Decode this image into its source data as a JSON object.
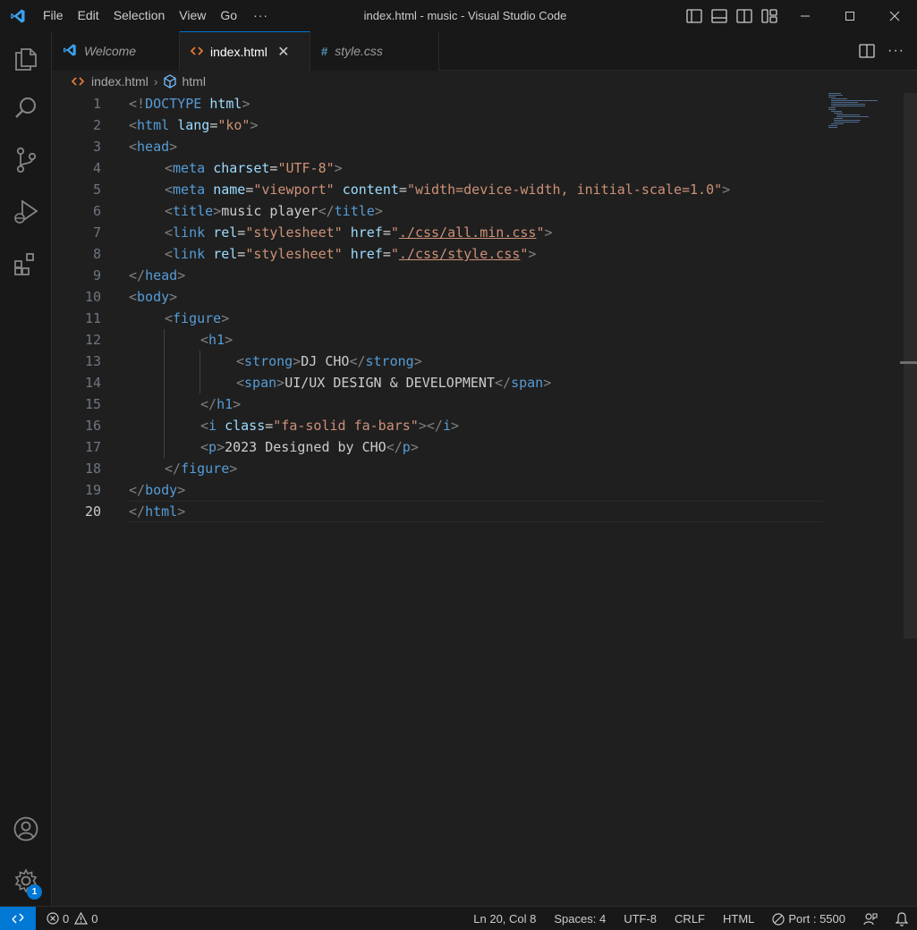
{
  "window": {
    "title": "index.html - music - Visual Studio Code",
    "menu": [
      "File",
      "Edit",
      "Selection",
      "View",
      "Go"
    ],
    "menu_more": "···"
  },
  "tabs": [
    {
      "label": "Welcome",
      "icon": "vscode-logo-icon",
      "active": false
    },
    {
      "label": "index.html",
      "icon": "html-file-icon",
      "active": true
    },
    {
      "label": "style.css",
      "icon": "css-file-icon",
      "icon_text": "#",
      "active": false
    }
  ],
  "breadcrumb": {
    "file": "index.html",
    "symbol": "html"
  },
  "editor": {
    "line_numbers": [
      "1",
      "2",
      "3",
      "4",
      "5",
      "6",
      "7",
      "8",
      "9",
      "10",
      "11",
      "12",
      "13",
      "14",
      "15",
      "16",
      "17",
      "18",
      "19",
      "20"
    ],
    "current_line": 20,
    "tokens": {
      "l1": [
        "<!",
        "DOCTYPE",
        " ",
        "html",
        ">"
      ],
      "l2": [
        "<",
        "html",
        " ",
        "lang",
        "=",
        "\"ko\"",
        ">"
      ],
      "l3": [
        "<",
        "head",
        ">"
      ],
      "l4": [
        "<",
        "meta",
        " ",
        "charset",
        "=",
        "\"UTF-8\"",
        ">"
      ],
      "l5": [
        "<",
        "meta",
        " ",
        "name",
        "=",
        "\"viewport\"",
        " ",
        "content",
        "=",
        "\"width=device-width, initial-scale=1.0\"",
        ">"
      ],
      "l6": [
        "<",
        "title",
        ">",
        "music player",
        "</",
        "title",
        ">"
      ],
      "l7": [
        "<",
        "link",
        " ",
        "rel",
        "=",
        "\"stylesheet\"",
        " ",
        "href",
        "=",
        "\"",
        "./css/all.min.css",
        "\"",
        ">"
      ],
      "l8": [
        "<",
        "link",
        " ",
        "rel",
        "=",
        "\"stylesheet\"",
        " ",
        "href",
        "=",
        "\"",
        "./css/style.css",
        "\"",
        ">"
      ],
      "l9": [
        "</",
        "head",
        ">"
      ],
      "l10": [
        "<",
        "body",
        ">"
      ],
      "l11": [
        "<",
        "figure",
        ">"
      ],
      "l12": [
        "<",
        "h1",
        ">"
      ],
      "l13": [
        "<",
        "strong",
        ">",
        "DJ CHO",
        "</",
        "strong",
        ">"
      ],
      "l14": [
        "<",
        "span",
        ">",
        "UI/UX DESIGN & DEVELOPMENT",
        "</",
        "span",
        ">"
      ],
      "l15": [
        "</",
        "h1",
        ">"
      ],
      "l16": [
        "<",
        "i",
        " ",
        "class",
        "=",
        "\"fa-solid fa-bars\"",
        "></",
        "i",
        ">"
      ],
      "l17": [
        "<",
        "p",
        ">",
        "2023 Designed by CHO",
        "</",
        "p",
        ">"
      ],
      "l18": [
        "</",
        "figure",
        ">"
      ],
      "l19": [
        "</",
        "body",
        ">"
      ],
      "l20": [
        "</",
        "html",
        ">"
      ]
    }
  },
  "activity_bar": {
    "items": [
      "explorer-icon",
      "search-icon",
      "source-control-icon",
      "run-debug-icon",
      "extensions-icon"
    ],
    "bottom": [
      "account-icon",
      "manage-gear-icon"
    ],
    "manage_badge": "1"
  },
  "status_bar": {
    "errors": "0",
    "warnings": "0",
    "cursor": "Ln 20, Col 8",
    "spaces": "Spaces: 4",
    "encoding": "UTF-8",
    "eol": "CRLF",
    "language": "HTML",
    "port": "Port : 5500"
  },
  "colors": {
    "accent": "#0078d4",
    "tag": "#569cd6",
    "attribute": "#9cdcfe",
    "string": "#ce9178",
    "punctuation": "#808080"
  }
}
